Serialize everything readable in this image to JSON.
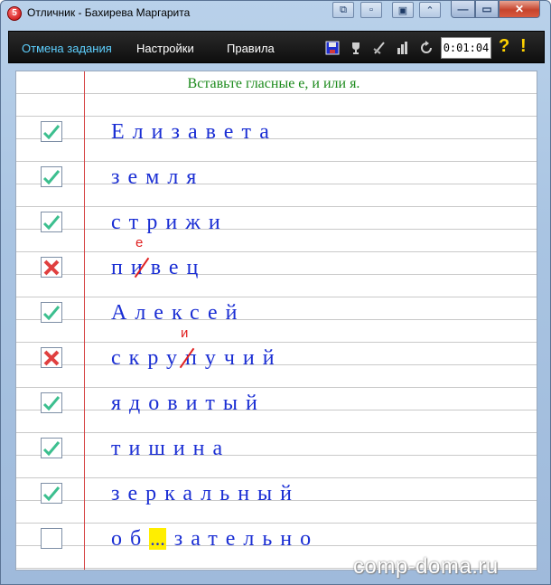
{
  "window": {
    "title": "Отличник - Бахирева Маргарита",
    "app_icon_label": "5"
  },
  "toolbar": {
    "undo_label": "Отмена задания",
    "settings_label": "Настройки",
    "rules_label": "Правила",
    "timer": "0:01:04",
    "help_label": "?",
    "warn_label": "!"
  },
  "exercise": {
    "instruction": "Вставьте гласные е, и или я.",
    "words": [
      {
        "text": "Елизавета",
        "status": "correct"
      },
      {
        "text": "земля",
        "status": "correct"
      },
      {
        "text": "стрижи",
        "status": "correct"
      },
      {
        "text": "пивец",
        "status": "wrong",
        "correction": "е"
      },
      {
        "text": "Алексей",
        "status": "correct"
      },
      {
        "text": "скрупучий",
        "status": "wrong",
        "correction": "и"
      },
      {
        "text": "ядовитый",
        "status": "correct"
      },
      {
        "text": "тишина",
        "status": "correct"
      },
      {
        "text": "зеркальный",
        "status": "correct"
      },
      {
        "prefix": "об",
        "gap": "...",
        "suffix": "зательно",
        "status": "current"
      }
    ]
  },
  "watermark": "comp-doma.ru",
  "colors": {
    "correct_check": "#3cbf8f",
    "wrong_cross": "#e04040",
    "word_text": "#1a2ed4",
    "instruction": "#1b8a1b",
    "correction": "#e02020",
    "highlight": "#ffee00"
  }
}
